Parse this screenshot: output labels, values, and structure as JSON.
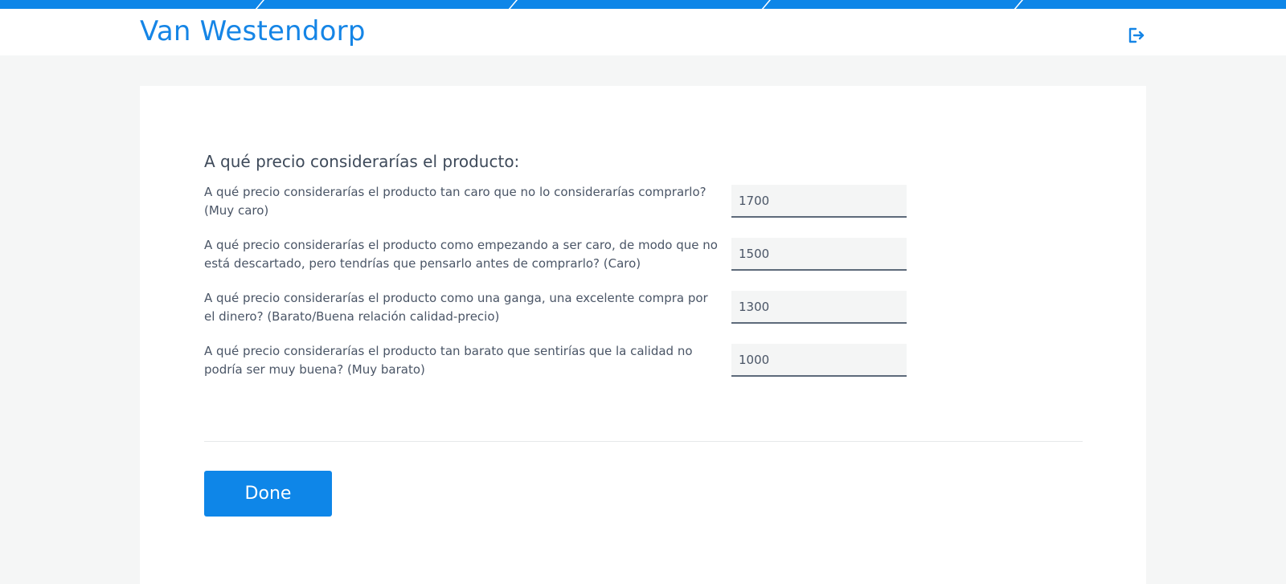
{
  "header": {
    "title": "Van Westendorp",
    "logout_icon": "logout-icon"
  },
  "colors": {
    "accent": "#0e86e8",
    "background": "#f5f6f6"
  },
  "form": {
    "heading": "A qué precio considerarías el producto:",
    "questions": [
      {
        "label": "A qué precio considerarías el producto tan caro que no lo considerarías comprarlo? (Muy caro)",
        "value": "1700"
      },
      {
        "label": "A qué precio considerarías el producto como empezando a ser caro, de modo que no está descartado, pero tendrías que pensarlo antes de comprarlo? (Caro)",
        "value": "1500"
      },
      {
        "label": "A qué precio considerarías el producto como una ganga, una excelente compra por el dinero? (Barato/Buena relación calidad-precio)",
        "value": "1300"
      },
      {
        "label": "A qué precio considerarías el producto tan barato que sentirías que la calidad no podría ser muy buena? (Muy barato)",
        "value": "1000"
      }
    ],
    "done_label": "Done"
  }
}
